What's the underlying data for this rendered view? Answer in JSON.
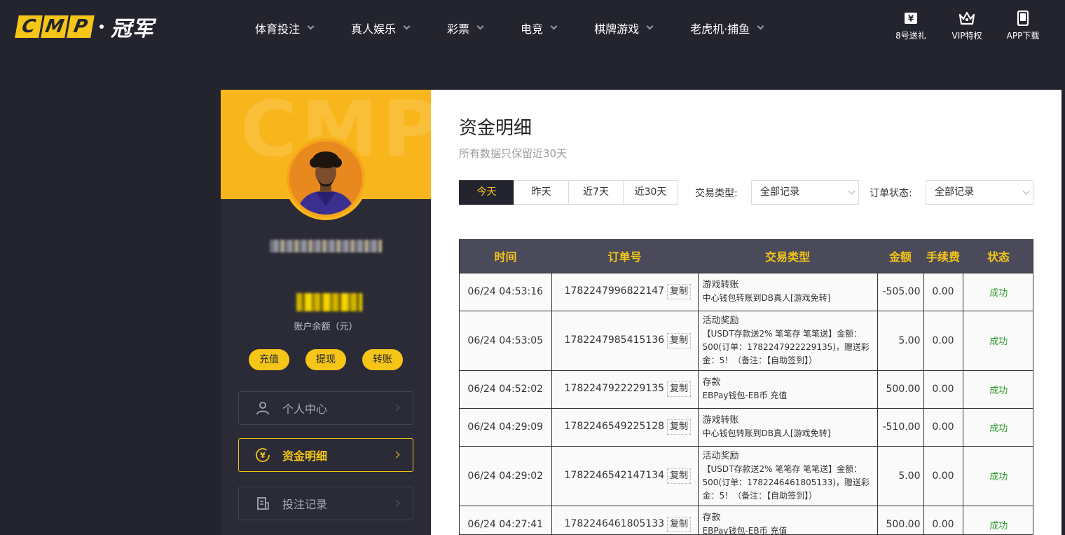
{
  "header": {
    "logo": {
      "cmp_letters": [
        "C",
        "M",
        "P"
      ],
      "text": "冠军"
    },
    "nav": [
      {
        "label": "体育投注"
      },
      {
        "label": "真人娱乐"
      },
      {
        "label": "彩票"
      },
      {
        "label": "电竞"
      },
      {
        "label": "棋牌游戏"
      },
      {
        "label": "老虎机·捕鱼"
      }
    ],
    "actions": [
      {
        "label": "8号送礼",
        "icon": "gift-yen-icon"
      },
      {
        "label": "VIP特权",
        "icon": "crown-icon"
      },
      {
        "label": "APP下载",
        "icon": "phone-icon"
      }
    ]
  },
  "sidebar": {
    "banner_watermark": "CMP",
    "balance_label": "账户余额（元）",
    "buttons": [
      {
        "label": "充值"
      },
      {
        "label": "提现"
      },
      {
        "label": "转账"
      }
    ],
    "menu": [
      {
        "label": "个人中心",
        "icon": "user-icon",
        "active": false
      },
      {
        "label": "资金明细",
        "icon": "yen-circle-icon",
        "active": true
      },
      {
        "label": "投注记录",
        "icon": "document-icon",
        "active": false
      }
    ]
  },
  "main": {
    "title": "资金明细",
    "subtitle": "所有数据只保留近30天",
    "tabs": [
      {
        "label": "今天",
        "active": true
      },
      {
        "label": "昨天",
        "active": false
      },
      {
        "label": "近7天",
        "active": false
      },
      {
        "label": "近30天",
        "active": false
      }
    ],
    "filters": {
      "type_label": "交易类型:",
      "type_value": "全部记录",
      "status_label": "订单状态:",
      "status_value": "全部记录"
    },
    "table": {
      "headers": [
        "时间",
        "订单号",
        "交易类型",
        "金额",
        "手续费",
        "状态"
      ],
      "copy_label": "复制",
      "rows": [
        {
          "time": "06/24 04:53:16",
          "order": "1782247996822147",
          "type_main": "游戏转账",
          "type_detail": "中心钱包转账到DB真人[游戏免转]",
          "amount": "-505.00",
          "fee": "0.00",
          "status": "成功"
        },
        {
          "time": "06/24 04:53:05",
          "order": "1782247985415136",
          "type_main": "活动奖励",
          "type_detail": "【USDT存款送2% 笔笔存 笔笔送】金额：500(订单：1782247922229135)，赠送彩金：5！（备注：【自助签到】）",
          "amount": "5.00",
          "fee": "0.00",
          "status": "成功"
        },
        {
          "time": "06/24 04:52:02",
          "order": "1782247922229135",
          "type_main": "存款",
          "type_detail": "EBPay钱包-EB币 充值",
          "amount": "500.00",
          "fee": "0.00",
          "status": "成功"
        },
        {
          "time": "06/24 04:29:09",
          "order": "1782246549225128",
          "type_main": "游戏转账",
          "type_detail": "中心钱包转账到DB真人[游戏免转]",
          "amount": "-510.00",
          "fee": "0.00",
          "status": "成功"
        },
        {
          "time": "06/24 04:29:02",
          "order": "1782246542147134",
          "type_main": "活动奖励",
          "type_detail": "【USDT存款送2% 笔笔存 笔笔送】金额：500(订单：1782246461805133)，赠送彩金：5！（备注：【自助签到】）",
          "amount": "5.00",
          "fee": "0.00",
          "status": "成功"
        },
        {
          "time": "06/24 04:27:41",
          "order": "1782246461805133",
          "type_main": "存款",
          "type_detail": "EBPay钱包-EB币 充值",
          "amount": "500.00",
          "fee": "0.00",
          "status": "成功"
        }
      ]
    }
  },
  "colors": {
    "accent": "#f5c518",
    "header_bg": "#24242f",
    "sidebar_bg": "#2b2b37",
    "banner_bg": "#f9b61c",
    "success": "#2e9a2e",
    "table_head_bg": "#4b4a5a"
  }
}
